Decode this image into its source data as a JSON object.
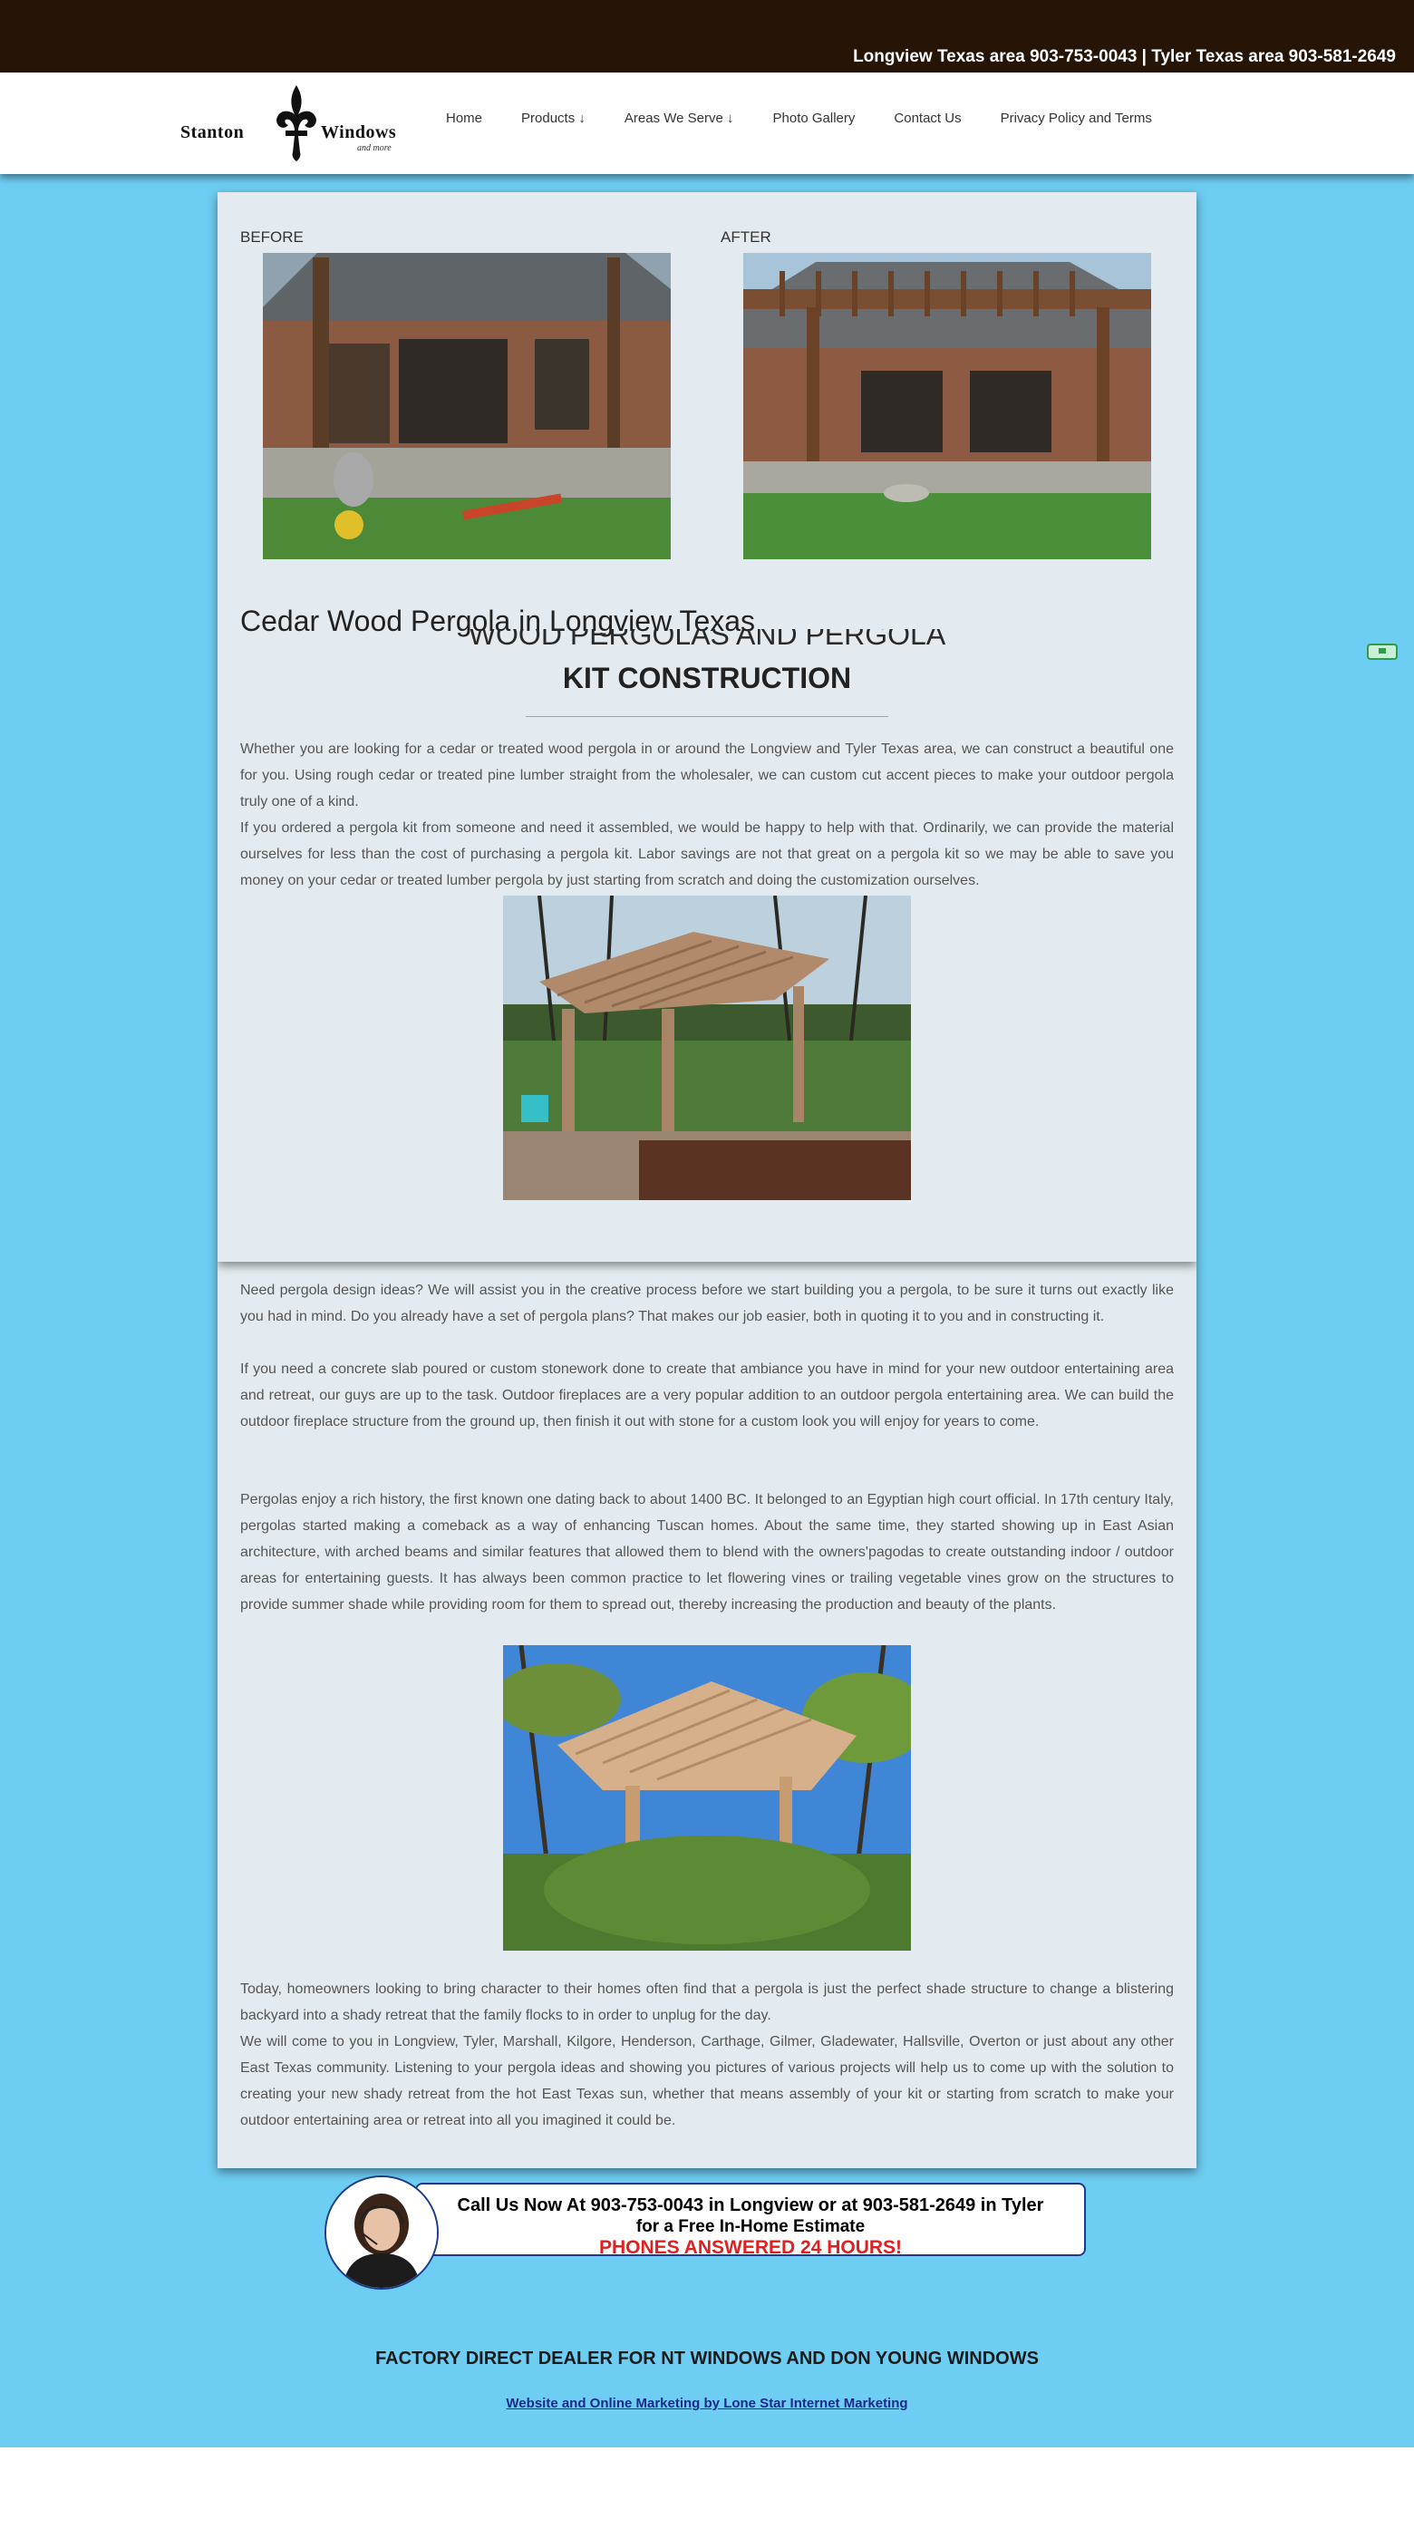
{
  "topbar": {
    "phones": "Longview Texas area 903-753-0043 | Tyler Texas area 903-581-2649"
  },
  "logo": {
    "word1": "Stanton",
    "word2": "Windows",
    "tagline": "and more"
  },
  "nav": {
    "items": [
      {
        "label": "Home"
      },
      {
        "label": "Products ↓"
      },
      {
        "label": "Areas We Serve ↓"
      },
      {
        "label": "Photo Gallery"
      },
      {
        "label": "Contact Us"
      },
      {
        "label": "Privacy Policy and Terms"
      }
    ]
  },
  "gallery": {
    "before_label": "BEFORE",
    "after_label": "AFTER"
  },
  "main": {
    "title": "Cedar Wood Pergola in Longview Texas",
    "subheading_line1": "WOOD PERGOLAS AND PERGOLA",
    "subheading_line2": "KIT CONSTRUCTION",
    "p1": "Whether you are looking for a cedar or treated wood pergola in or around the Longview and Tyler Texas area, we can construct a beautiful one for you. Using rough cedar or treated pine lumber straight from the wholesaler, we can custom cut accent pieces to make your outdoor pergola truly one of a kind.",
    "p2": "If you ordered a pergola kit from someone and need it assembled, we would be happy to help with that. Ordinarily, we can provide the material ourselves for less than the cost of purchasing a pergola kit. Labor savings are not that great on a pergola kit so we may be able to save you money on your cedar or treated lumber pergola by just starting from scratch and doing the customization ourselves.",
    "p3": "Need pergola design ideas? We will assist you in the creative process before we start building you a pergola, to be sure it turns out exactly like you had in mind. Do you already have a set of pergola plans? That makes our job easier, both in quoting it to you and in constructing it.",
    "p4": "If you need a concrete slab poured or custom stonework done to create that ambiance you have in mind for your new outdoor entertaining area and retreat, our guys are up to the task. Outdoor fireplaces are a very popular addition to an outdoor pergola entertaining area. We can build the outdoor fireplace structure from the ground up, then finish it out with stone for a custom look you will enjoy for years to come.",
    "p5": "Pergolas enjoy a rich history, the first known one dating back to about 1400 BC. It belonged to an Egyptian high court official. In 17th century Italy, pergolas started making a comeback as a way of enhancing Tuscan homes. About the same time, they started showing up in East Asian architecture, with arched beams and similar features that allowed them to blend with the owners'pagodas to create outstanding indoor / outdoor areas for entertaining guests. It has always been common practice to let flowering vines or trailing vegetable vines grow on the structures to provide summer shade while providing room for them to spread out, thereby increasing the production and beauty of the plants.",
    "p6": "Today, homeowners looking to bring character to their homes often find that a pergola is just the perfect shade structure to change a blistering backyard into a shady retreat that the family flocks to in order to unplug for the day.",
    "p7": "We will come to you in Longview, Tyler, Marshall, Kilgore, Henderson, Carthage, Gilmer, Gladewater, Hallsville, Overton or just about any other East Texas community. Listening to your pergola ideas and showing you pictures of various projects will help us to come up with the solution to creating your new shady retreat from the hot East Texas sun, whether that means assembly of your kit or starting from scratch to make your outdoor entertaining area or retreat into all you imagined it could be."
  },
  "cta": {
    "line1": "Call Us Now At 903-753-0043 in Longview or at 903-581-2649 in Tyler",
    "line2": "for a Free In-Home Estimate",
    "line3": "PHONES ANSWERED 24 HOURS!"
  },
  "footer": {
    "dealer": "FACTORY DIRECT DEALER FOR NT WINDOWS AND DON YOUNG WINDOWS",
    "credit": "Website and Online Marketing by Lone Star Internet Marketing"
  },
  "colors": {
    "topbar": "#261507",
    "page_background": "#6ecdf2",
    "content_panel": "#e3ebf0",
    "cta_red": "#e02020",
    "cta_border": "#1a3b8a",
    "footer_link": "#1c2a8c"
  },
  "icons": [
    "fleur-de-lis-icon",
    "chat-badge-icon"
  ]
}
